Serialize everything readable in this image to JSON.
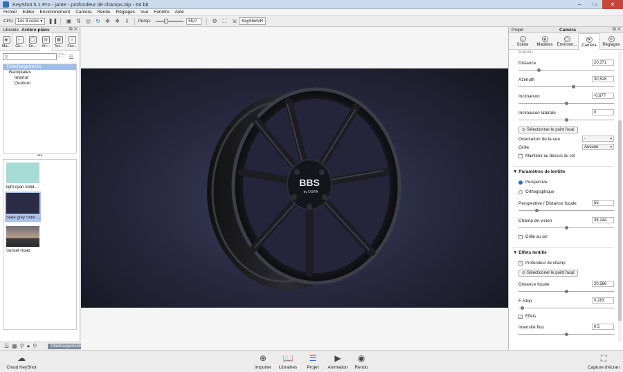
{
  "window": {
    "title": "KeyShot 5.1 Pro  -  jante - profondeur de champs.bip  -  64 bit"
  },
  "menu": [
    "Fichier",
    "Editer",
    "Environnement",
    "Caméra",
    "Rendu",
    "Réglages",
    "Vue",
    "Fenêtre",
    "Aide"
  ],
  "toolbar": {
    "cpu_label": "CPU",
    "cores_value": "Les 8 cores",
    "persp_label": "Persp.",
    "persp_value": "55,0",
    "keyshotvr_label": "KeyShotVR"
  },
  "library": {
    "tab_label": "Librairie",
    "panel_title": "Arrière-plans",
    "tabs": [
      "Ma...",
      "Co...",
      "En...",
      "Arr...",
      "Tex...",
      "Fav..."
    ],
    "tree": [
      "Téléchargements",
      "Backplates",
      "Interior",
      "Outdoor"
    ],
    "thumbnails": [
      "light cyan Solid ...",
      "Slate grey Solid ...",
      "Sunset Road"
    ],
    "bottom_button": "Téléchargements"
  },
  "project": {
    "tab_label": "Projet",
    "panel_title": "Caméra",
    "tabs": [
      "Scène",
      "Matières",
      "Environn...",
      "Caméra",
      "Réglages"
    ],
    "partial_label": "Autoriu",
    "fields": {
      "distance": {
        "label": "Distance",
        "value": "20,371",
        "slider": 0.2
      },
      "azimuth": {
        "label": "Azimuth",
        "value": "30,528",
        "slider": 0.58
      },
      "inclination": {
        "label": "Inclinaison",
        "value": "-0,677",
        "slider": 0.5
      },
      "lateral": {
        "label": "Inclinaison latérale",
        "value": "0",
        "slider": 0.5
      }
    },
    "select_focus_button": "Sélectionner le point focal",
    "view_orientation_label": "Orientation de la vue",
    "view_orientation_value": "-",
    "grid_label": "Grille",
    "grid_value": "Aucune",
    "keep_above_ground": "Maintenir au dessus du sol",
    "lens_section": "Paramètres de lentille",
    "perspective": "Perspective",
    "orthographic": "Orthographique",
    "focal": {
      "label": "Perspective / Distance focale",
      "value": "55",
      "slider": 0.18
    },
    "fov": {
      "label": "Champ de vision",
      "value": "36,244",
      "slider": 0.5
    },
    "ground_grid": "Grille au sol",
    "effects_section": "Effets lentille",
    "dof": "Profondeur de champ",
    "select_focus_button2": "Sélectionner le point focal",
    "focus_distance": {
      "label": "Distance focale",
      "value": "20,586",
      "slider": 0.5
    },
    "fstop": {
      "label": "F-Stop",
      "value": "0,283",
      "slider": 0.02
    },
    "effects": "Effets",
    "blur": {
      "label": "Intensité flou",
      "value": "0,5",
      "slider": 0.5
    }
  },
  "bottom": {
    "cloud": "Cloud KeyShot",
    "importer": "Importer",
    "libraries": "Librairies",
    "project": "Projet",
    "animation": "Animation",
    "render": "Rendu",
    "screenshot": "Capture d'écran"
  },
  "render": {
    "brand_text": "BBS",
    "sub_text": "by DURA"
  }
}
